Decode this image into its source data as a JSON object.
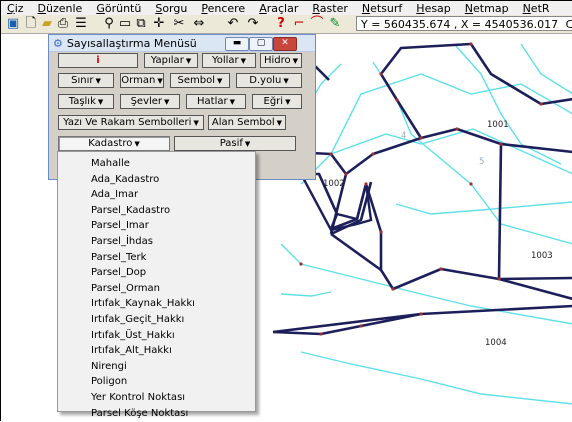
{
  "menubar": {
    "items": [
      "Çiz",
      "Düzenle",
      "Görüntü",
      "Sorgu",
      "Pencere",
      "Araçlar",
      "Raster",
      "Netsurf",
      "Hesap",
      "Netmap",
      "NetR"
    ]
  },
  "toolbar": {
    "coordinate": "Y = 560435.674 , X = 4540536.017",
    "coordinate_tail": "Cu"
  },
  "window": {
    "title": "Sayısallaştırma Menüsü",
    "buttons": {
      "i": "i",
      "yapilar": "Yapılar",
      "yollar": "Yollar",
      "hidro": "Hidro",
      "sinir": "Sınır",
      "orman": "Orman",
      "sembol": "Sembol",
      "dyolu": "D.yolu",
      "taslik": "Taşlık",
      "sevler": "Şevler",
      "hatlar": "Hatlar",
      "egri": "Eğri",
      "yazi": "Yazı Ve Rakam Sembolleri",
      "alan": "Alan Sembol",
      "kadastro": "Kadastro",
      "pasif": "Pasif"
    }
  },
  "dropdown": {
    "items": [
      "Mahalle",
      "Ada_Kadastro",
      "Ada_Imar",
      "Parsel_Kadastro",
      "Parsel_Imar",
      "Parsel_İhdas",
      "Parsel_Terk",
      "Parsel_Dop",
      "Parsel_Orman",
      "Irtıfak_Kaynak_Hakkı",
      "Irtıfak_Geçit_Hakkı",
      "Irtıfak_Üst_Hakkı",
      "Irtıfak_Alt_Hakkı",
      "Nirengi",
      "Poligon",
      "Yer Kontrol Noktası",
      "Parsel Köşe Noktası"
    ]
  },
  "map": {
    "labels": {
      "p1001": "1001",
      "p1002": "1002",
      "p1003": "1003",
      "p1004": "1004",
      "n4": "4",
      "n5": "5"
    }
  }
}
